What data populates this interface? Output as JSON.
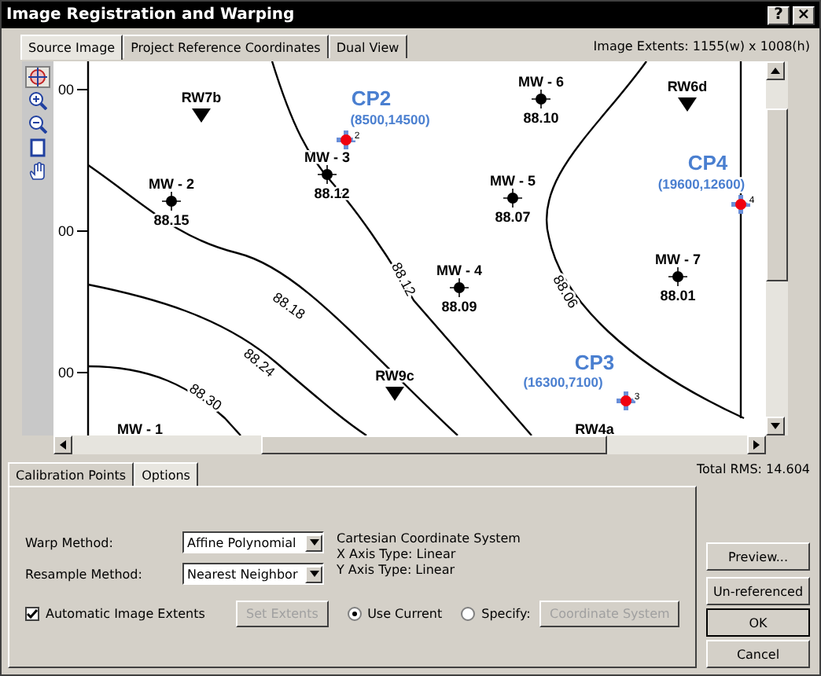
{
  "window": {
    "title": "Image Registration and Warping",
    "buttons": [
      {
        "label": "?"
      },
      {
        "label": "×"
      }
    ]
  },
  "view_tabs": [
    {
      "label": "Source Image",
      "selected": true
    },
    {
      "label": "Project Reference Coordinates",
      "selected": false
    },
    {
      "label": "Dual View",
      "selected": false
    }
  ],
  "image_extents": "Image Extents: 1155(w) x 1008(h)",
  "tools": [
    {
      "kind": "crosshair",
      "selected": true
    },
    {
      "kind": "zoom-in",
      "selected": false
    },
    {
      "kind": "zoom-out",
      "selected": false
    },
    {
      "kind": "fit",
      "selected": false
    },
    {
      "kind": "hand",
      "selected": false
    }
  ],
  "map": {
    "axis_labels": [
      "00",
      "00",
      "00"
    ],
    "recovery_wells": [
      {
        "name": "RW7b"
      },
      {
        "name": "RW6d"
      },
      {
        "name": "RW9c"
      },
      {
        "name": "RW4a"
      }
    ],
    "monitoring_wells": [
      {
        "name": "MW - 2",
        "value": "88.15"
      },
      {
        "name": "MW - 3",
        "value": "88.12"
      },
      {
        "name": "MW - 6",
        "value": "88.10"
      },
      {
        "name": "MW - 5",
        "value": "88.07"
      },
      {
        "name": "MW - 4",
        "value": "88.09"
      },
      {
        "name": "MW - 7",
        "value": "88.01"
      },
      {
        "name": "MW - 1"
      }
    ],
    "control_points": [
      {
        "name": "CP2",
        "coords": "(8500,14500)",
        "number": "2"
      },
      {
        "name": "CP4",
        "coords": "(19600,12600)",
        "number": "4"
      },
      {
        "name": "CP3",
        "coords": "(16300,7100)",
        "number": "3"
      }
    ],
    "contour_labels": [
      "88.12",
      "88.06",
      "88.18",
      "88.24",
      "88.30"
    ]
  },
  "lower_tabs": [
    {
      "label": "Calibration Points",
      "selected": false
    },
    {
      "label": "Options",
      "selected": true
    }
  ],
  "total_rms": "Total RMS: 14.604",
  "options": {
    "warp_method": {
      "label": "Warp Method:",
      "value": "Affine Polynomial"
    },
    "resample_method": {
      "label": "Resample Method:",
      "value": "Nearest Neighbor"
    },
    "coordinate_info": [
      "Cartesian Coordinate System",
      "X Axis Type: Linear",
      "Y Axis Type: Linear"
    ],
    "automatic_extents": {
      "label": "Automatic Image Extents",
      "checked": true
    },
    "set_extents": {
      "label": "Set Extents",
      "disabled": true
    },
    "coordinate_choices": [
      {
        "label": "Use Current",
        "selected": true
      },
      {
        "label": "Specify:",
        "selected": false
      }
    ],
    "coordinate_system": {
      "label": "Coordinate System",
      "disabled": true
    }
  },
  "buttons": [
    {
      "label": "Preview...",
      "kind": "normal"
    },
    {
      "label": "Un-referenced",
      "kind": "normal"
    },
    {
      "label": "OK",
      "kind": "default"
    },
    {
      "label": "Cancel",
      "kind": "normal"
    }
  ]
}
